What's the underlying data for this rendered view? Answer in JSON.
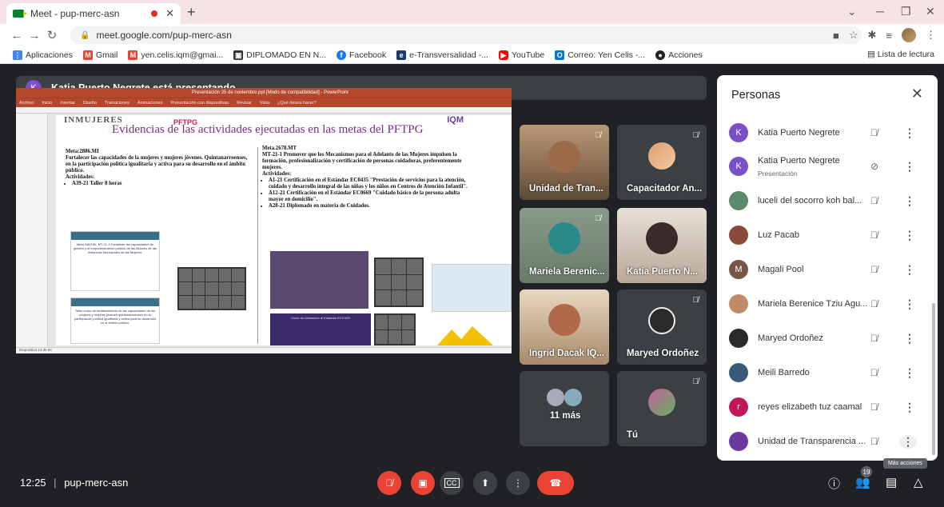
{
  "browser": {
    "tab_title": "Meet - pup-merc-asn",
    "tab_close": "✕",
    "new_tab": "+",
    "url": "meet.google.com/pup-merc-asn",
    "bookmarks": [
      {
        "label": "Aplicaciones",
        "icon": "apps-grid-icon",
        "color": "#4285f4"
      },
      {
        "label": "Gmail",
        "icon": "gmail-icon",
        "color": "#ea4335"
      },
      {
        "label": "yen.celis.iqm@gmai...",
        "icon": "gmail-icon",
        "color": "#ea4335"
      },
      {
        "label": "DIPLOMADO EN N...",
        "icon": "doc-icon",
        "color": "#333333"
      },
      {
        "label": "Facebook",
        "icon": "facebook-icon",
        "color": "#1877f2"
      },
      {
        "label": "e-Transversalidad -...",
        "icon": "site-icon",
        "color": "#1a3a6a"
      },
      {
        "label": "YouTube",
        "icon": "youtube-icon",
        "color": "#ff0000"
      },
      {
        "label": "Correo: Yen Celis -...",
        "icon": "outlook-icon",
        "color": "#0078d4"
      },
      {
        "label": "Acciones",
        "icon": "github-icon",
        "color": "#222222"
      }
    ],
    "reading_list": "Lista de lectura"
  },
  "meet": {
    "presenting_banner": "Katia Puerto Negrete está presentando",
    "presenter_initial": "K",
    "clock": "12:25",
    "separator": "|",
    "meeting_code": "pup-merc-asn",
    "participants_badge": "19",
    "more_actions_tooltip": "Más acciones"
  },
  "slide": {
    "window_title": "Presentación 25 de noviembre.ppt [Modo de compatibilidad] - PowerPoint",
    "menu": [
      "Archivo",
      "Inicio",
      "Insertar",
      "Diseño",
      "Transiciones",
      "Animaciones",
      "Presentación con diapositivas",
      "Revisar",
      "Vista",
      "¿Qué desea hacer?"
    ],
    "org_left": "INMUJERES",
    "program": "PFTPG",
    "org_right": "IQM",
    "title": "Evidencias de las actividades ejecutadas en las metas del PFTPG",
    "left_col": {
      "meta": "Meta:2886.MI",
      "body": "Fortalecer las capacidades de la mujeres y mujeres jóvenes. Quintanarroenses, en la participación política igualitaria y activa para su desarrollo en el ámbito público.",
      "act_label": "Actividades:",
      "items": [
        "A39-21 Taller 8 horas"
      ]
    },
    "right_col": {
      "meta": "Meta.2678.MT",
      "body": "MT-21-1 Promover que los Mecanismos para el Adelanto de las Mujeres impulsen la formación, profesionalización y certificación de personas cuidadoras, preferentemente mujeres.",
      "act_label": "Actividades:",
      "items": [
        "A1-21 Certificación en el Estándar EC0435 \"Prestación de servicios para la atención, cuidado y desarrollo integral de las niñas y los niños en Centros de Atención Infantil\".",
        "A12-21 Certificación en el Estándar EC0669 \"Cuidado básico de la persona adulta mayor en domicilio\".",
        "A28-21 Diplomado en materia de Cuidados."
      ]
    },
    "mini1_text": "Meta 2683.MI. MT-21-3 Fortalecer las capacidades de gestión y el empoderamiento político de las titulares de las Instancias Municipales de las Mujeres.",
    "mini2_text": "Taller curso de fortalecimiento de las capacidades de las mujeres y mujeres jóvenes quintanarroenses en la participación política igualitaria y activa para su desarrollo en el ámbito público.",
    "mini3_text": "Curso de Alineación al Estándar EC0 669",
    "status": "Diapositiva 14 de 66"
  },
  "tiles": [
    {
      "name": "Unidad de Tran...",
      "muted": true,
      "bg": "#a88a6a"
    },
    {
      "name": "Capacitador An...",
      "muted": true,
      "bg": "#3c4043"
    },
    {
      "name": "Mariela Berenic...",
      "muted": true,
      "bg": "#7a8a7a"
    },
    {
      "name": "Katia Puerto N...",
      "muted": false,
      "bg": "#c8c0b8"
    },
    {
      "name": "Ingrid Dacak IQ...",
      "muted": false,
      "bg": "#b89a80"
    },
    {
      "name": "Maryed Ordoñez",
      "muted": true,
      "bg": "#3c4043"
    },
    {
      "name": "11 más",
      "muted": false,
      "bg": "#3c4043"
    },
    {
      "name": "Tú",
      "muted": true,
      "bg": "#3c4043"
    }
  ],
  "people_panel": {
    "title": "Personas",
    "close": "✕",
    "people": [
      {
        "name": "Katia Puerto Negrete",
        "sub": "",
        "initial": "K",
        "color": "#7b4fc7"
      },
      {
        "name": "Katia Puerto Negrete",
        "sub": "Presentación",
        "initial": "K",
        "color": "#7b4fc7"
      },
      {
        "name": "luceli del socorro koh bal...",
        "sub": "",
        "initial": "",
        "color": "#5a8a6a"
      },
      {
        "name": "Luz Pacab",
        "sub": "",
        "initial": "",
        "color": "#8a4a3a"
      },
      {
        "name": "Magali Pool",
        "sub": "",
        "initial": "M",
        "color": "#795548"
      },
      {
        "name": "Mariela Berenice Tziu Agu...",
        "sub": "",
        "initial": "",
        "color": "#c08a6a"
      },
      {
        "name": "Maryed Ordoñez",
        "sub": "",
        "initial": "",
        "color": "#2a2a2a"
      },
      {
        "name": "Meili Barredo",
        "sub": "",
        "initial": "",
        "color": "#3a5a7a"
      },
      {
        "name": "reyes elizabeth tuz caamal",
        "sub": "",
        "initial": "r",
        "color": "#c2185b"
      },
      {
        "name": "Unidad de Transparencia ...",
        "sub": "",
        "initial": "",
        "color": "#6a3aa0"
      }
    ]
  },
  "colors": {
    "accent_red": "#ea4335",
    "meet_bg": "#202124",
    "tile_bg": "#3c4043",
    "ppt_red": "#b7472a"
  }
}
